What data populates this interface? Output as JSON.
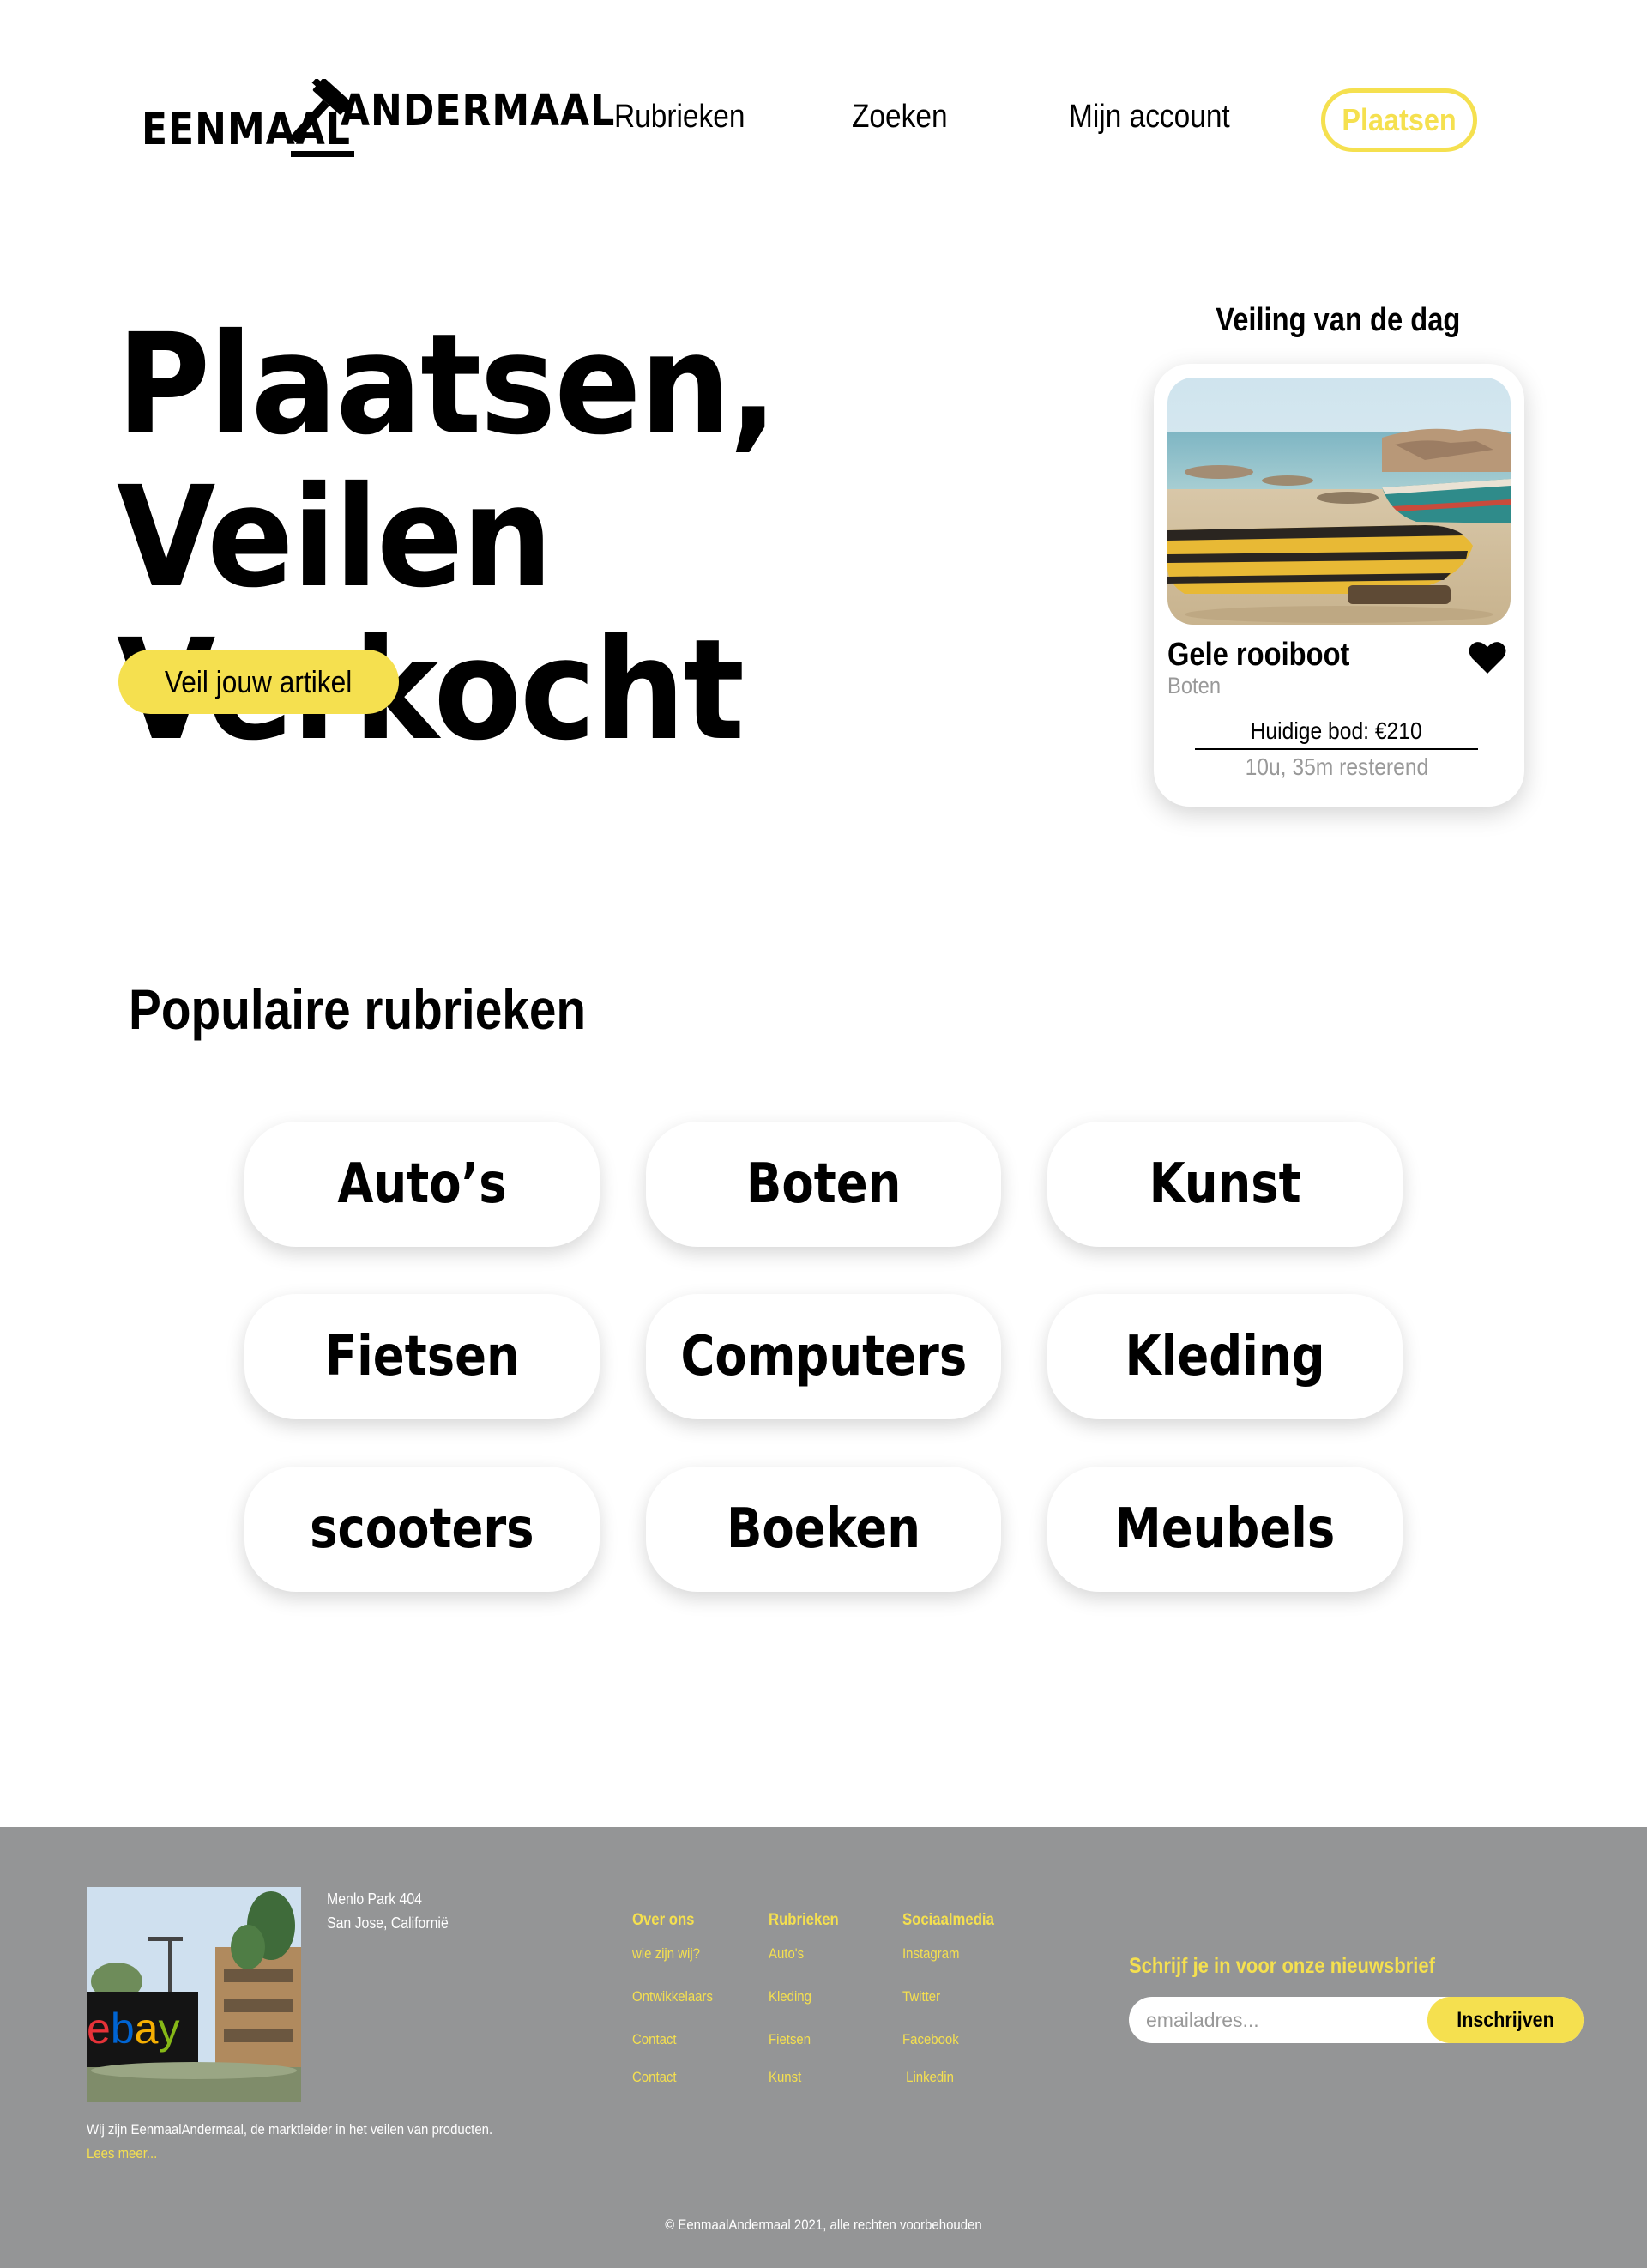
{
  "header": {
    "logo_left": "EENMAAL",
    "logo_right": "ANDERMAAL",
    "nav": {
      "rubrieken": "Rubrieken",
      "zoeken": "Zoeken",
      "account": "Mijn account",
      "plaatsen": "Plaatsen"
    }
  },
  "hero": {
    "title_line1": "Plaatsen, Veilen",
    "title_line2": "Verkocht",
    "cta": "Veil jouw artikel"
  },
  "auction_of_the_day": {
    "heading": "Veiling van de dag",
    "title": "Gele rooiboot",
    "category": "Boten",
    "bid": "Huidige bod: €210",
    "time_left": "10u, 35m resterend"
  },
  "categories": {
    "title": "Populaire rubrieken",
    "items": [
      "Auto’s",
      "Boten",
      "Kunst",
      "Fietsen",
      "Computers",
      "Kleding",
      "scooters",
      "Boeken",
      "Meubels"
    ]
  },
  "footer": {
    "image_sign_text": "ebay",
    "address_line1": "Menlo Park 404",
    "address_line2": "San Jose, Californië",
    "about": "Wij zijn EenmaalAndermaal, de marktleider in het veilen van producten.",
    "read_more": "Lees meer...",
    "columns": [
      {
        "heading": "Over ons",
        "links": [
          "wie zijn wij?",
          "Ontwikkelaars",
          "Contact",
          "Contact"
        ]
      },
      {
        "heading": "Rubrieken",
        "links": [
          "Auto's",
          "Kleding",
          "Fietsen",
          "Kunst"
        ]
      },
      {
        "heading": "Sociaalmedia",
        "links": [
          "Instagram",
          "Twitter",
          "Facebook",
          " Linkedin"
        ]
      }
    ],
    "newsletter": {
      "label": "Schrijf je in voor onze nieuwsbrief",
      "placeholder": "emailadres...",
      "button": "Inschrijven"
    },
    "copyright": "© EenmaalAndermaal 2021, alle rechten voorbehouden"
  },
  "colors": {
    "accent_yellow": "#f5e04f",
    "footer_gray": "#949596",
    "muted_text": "#999999"
  }
}
